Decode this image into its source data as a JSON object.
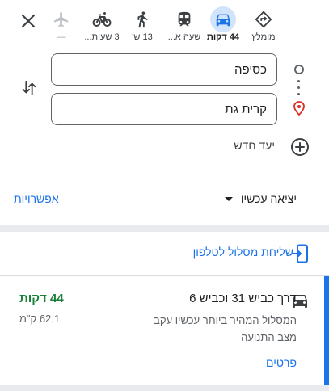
{
  "travel_modes": [
    {
      "label": "מומלץ",
      "icon": "diamond-directions-icon"
    },
    {
      "label": "44 דקות",
      "icon": "car-icon",
      "active": true
    },
    {
      "label": "שעה א...",
      "icon": "transit-icon"
    },
    {
      "label": "13 ש'",
      "icon": "walk-icon"
    },
    {
      "label": "3 שעות...",
      "icon": "bike-icon"
    },
    {
      "label": "—",
      "icon": "flight-icon",
      "disabled": true
    }
  ],
  "origin": {
    "value": "כסיפה"
  },
  "destination": {
    "value": "קרית גת"
  },
  "add_destination_label": "יעד חדש",
  "depart_label": "יציאה עכשיו",
  "options_label": "אפשרויות",
  "send_to_phone_label": "שליחת מסלול לטלפון",
  "route": {
    "title": "דרך כביש 31 וכביש 6",
    "description": "המסלול המהיר ביותר עכשיו עקב מצב התנועה",
    "details_label": "פרטים",
    "duration": "44 דקות",
    "distance": "62.1 ק\"מ"
  },
  "colors": {
    "accent": "#1a73e8",
    "duration_green": "#188038",
    "active_chip": "#d2e3fc",
    "pin_red": "#d93025"
  }
}
